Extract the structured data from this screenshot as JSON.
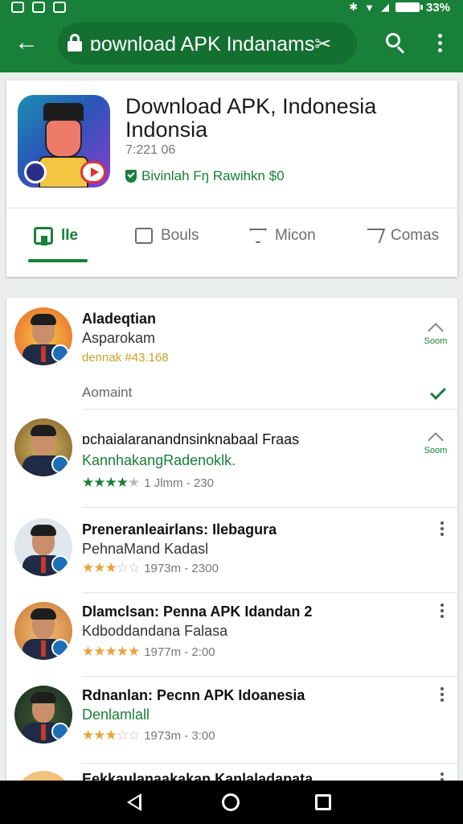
{
  "status_bar": {
    "right_text": "33%",
    "battery_label": ""
  },
  "toolbar": {
    "url_text": "ɒownload APK Indanams✂"
  },
  "app": {
    "title": "Download APK, Indonesia Indonsia",
    "meta": "7:221 06",
    "verified_text": "Bivinlah Fŋ Rawihkn $0"
  },
  "tabs": [
    {
      "label": "lle"
    },
    {
      "label": "Bouls"
    },
    {
      "label": "Micon"
    },
    {
      "label": "Comas"
    }
  ],
  "side_label": "Soom",
  "results": [
    {
      "title": "Aladeqtian",
      "subtitle": "Asparokam",
      "meta": "dennak #43.168",
      "extra": "Aomaint",
      "stars_on": 0,
      "star_color": "",
      "rating_text": ""
    },
    {
      "title": "ɒchaialaranandnsinknabaal Fraas",
      "subtitle": "KannhakangRadenoklk.",
      "meta": "",
      "extra": "",
      "stars_on": 4,
      "star_color": "green",
      "rating_text": "1 Jlmm - 230"
    },
    {
      "title": "Preneranleairlans: Ilebagura",
      "subtitle": "PehnaMand Kadasl",
      "meta": "",
      "extra": "",
      "stars_on": 3,
      "star_color": "orange",
      "rating_text": "1973m - 2300"
    },
    {
      "title": "Dlamclsan: Penna APK Idandan 2",
      "subtitle": "Kdboddandana Falasa",
      "meta": "",
      "extra": "",
      "stars_on": 5,
      "star_color": "orange",
      "rating_text": "1977m - 2:00"
    },
    {
      "title": "Rdnanlan: Pecnn APK Idoanesia",
      "subtitle": "Denlamlall",
      "meta": "",
      "extra": "",
      "stars_on": 3,
      "star_color": "orange",
      "rating_text": "1973m - 3:00"
    },
    {
      "title": "Eekkaulanaakakan Kanlaladapata",
      "subtitle": "",
      "meta": "",
      "extra": "",
      "stars_on": 0,
      "star_color": "",
      "rating_text": ""
    }
  ],
  "colors": {
    "brand": "#188038",
    "star_orange": "#e8a33c"
  },
  "icons": {
    "toolbar": [
      "back-arrow-icon",
      "lock-icon",
      "search-icon",
      "more-vert-icon"
    ],
    "tabs": [
      "install-icon",
      "chat-icon",
      "flag-icon",
      "share-icon"
    ],
    "nav": [
      "nav-back-icon",
      "nav-home-icon",
      "nav-recents-icon"
    ]
  }
}
